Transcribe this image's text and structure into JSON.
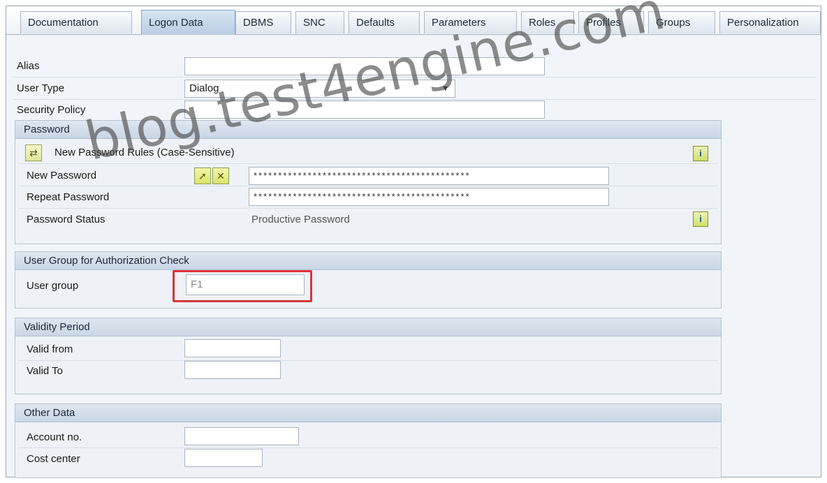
{
  "tabs": [
    "Documentation",
    "Logon Data",
    "DBMS",
    "SNC",
    "Defaults",
    "Parameters",
    "Roles",
    "Profiles",
    "Groups",
    "Personalization"
  ],
  "active_tab": "Logon Data",
  "fields": {
    "alias": {
      "label": "Alias",
      "value": ""
    },
    "user_type": {
      "label": "User Type",
      "value": "Dialog"
    },
    "security_policy": {
      "label": "Security Policy",
      "value": ""
    }
  },
  "password_group": {
    "title": "Password",
    "rules_label": "New Password Rules (Case-Sensitive)",
    "new_password_label": "New Password",
    "new_password_value": "********************************************",
    "repeat_password_label": "Repeat Password",
    "repeat_password_value": "********************************************",
    "status_label": "Password Status",
    "status_value": "Productive Password"
  },
  "user_group_section": {
    "title": "User Group for Authorization Check",
    "label": "User group",
    "value": "F1"
  },
  "validity": {
    "title": "Validity Period",
    "valid_from_label": "Valid from",
    "valid_from_value": "",
    "valid_to_label": "Valid To",
    "valid_to_value": ""
  },
  "other_data": {
    "title": "Other Data",
    "account_label": "Account no.",
    "account_value": "",
    "cost_center_label": "Cost center",
    "cost_center_value": ""
  },
  "icons": {
    "rules": "password-rules-icon",
    "generate": "generate-password-icon",
    "deactivate": "deactivate-password-icon",
    "info": "info-icon",
    "dropdown": "dropdown-arrow-icon"
  },
  "colors": {
    "highlight": "#d9343a",
    "active_tab": "#b9cde4",
    "group_header": "#c9d6e5"
  },
  "watermark": "blog.test4engine.com"
}
